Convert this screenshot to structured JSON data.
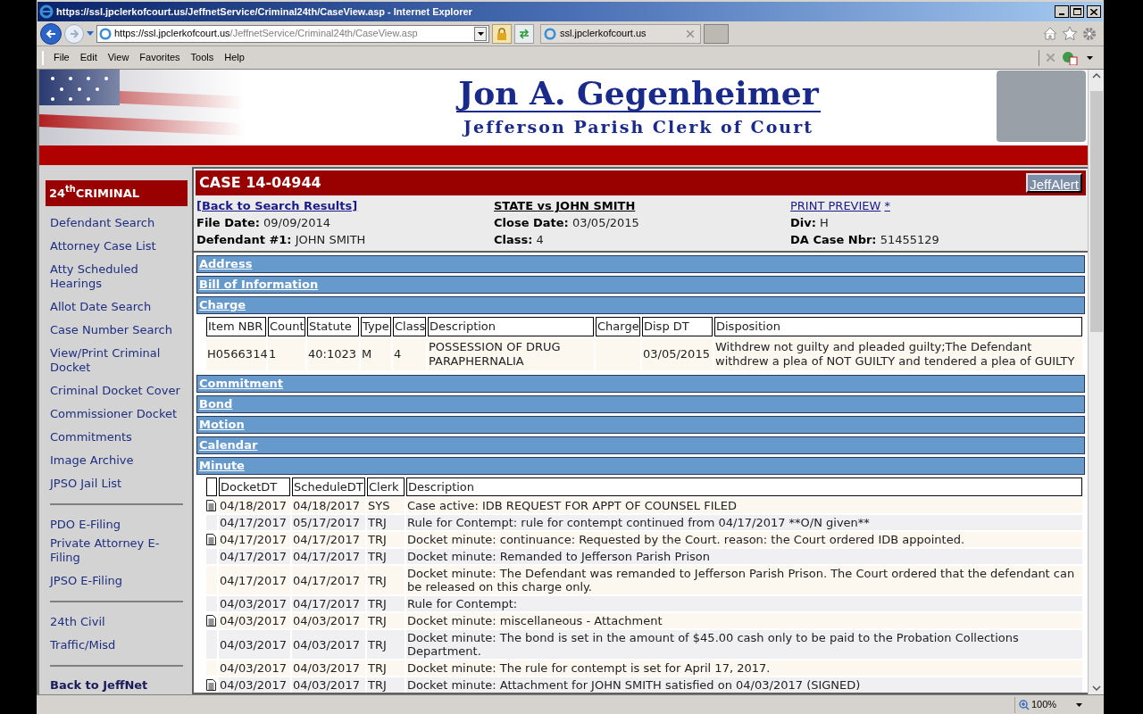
{
  "browser": {
    "title": "https://ssl.jpclerkofcourt.us/JeffnetService/Criminal24th/CaseView.asp - Internet Explorer",
    "address_host": "https://ssl.jpclerkofcourt.us",
    "address_path": "/JeffnetService/Criminal24th/CaseView.asp",
    "tab": "ssl.jpclerkofcourt.us",
    "menu": [
      "File",
      "Edit",
      "View",
      "Favorites",
      "Tools",
      "Help"
    ],
    "zoom": "100%"
  },
  "banner": {
    "name": "Jon A. Gegenheimer",
    "subtitle": "Jefferson Parish Clerk of Court"
  },
  "sidebar": {
    "header": "24$^{th}$CRIMINAL",
    "groups": [
      [
        {
          "label": "Defendant Search",
          "kind": "link"
        },
        {
          "label": "Attorney Case List",
          "kind": "link"
        },
        {
          "label": "Atty Scheduled Hearings",
          "kind": "link"
        },
        {
          "label": "Allot Date Search",
          "kind": "link"
        },
        {
          "label": "Case Number Search",
          "kind": "link"
        },
        {
          "label": "View/Print Criminal Docket",
          "kind": "link"
        },
        {
          "label": "Criminal Docket Cover",
          "kind": "link"
        },
        {
          "label": "Commissioner Docket",
          "kind": "link"
        },
        {
          "label": "Commitments",
          "kind": "link"
        },
        {
          "label": "Image Archive",
          "kind": "link"
        },
        {
          "label": "JPSO Jail List",
          "kind": "link"
        }
      ],
      [
        {
          "label": "PDO E-Filing",
          "kind": "tight"
        },
        {
          "label": "Private Attorney E-Filing",
          "kind": "link"
        },
        {
          "label": "JPSO E-Filing",
          "kind": "link"
        }
      ],
      [
        {
          "label": "24th Civil",
          "kind": "link"
        },
        {
          "label": "Traffic/Misd",
          "kind": "link"
        }
      ],
      [
        {
          "label": "Back to JeffNet",
          "kind": "bold"
        }
      ]
    ]
  },
  "case": {
    "title": "CASE 14-04944",
    "alert_button": "JeffAlert",
    "back_link": "[Back to Search Results]",
    "parties": "STATE vs JOHN SMITH",
    "print_link": "PRINT PREVIEW",
    "print_mark": "*",
    "fields": [
      {
        "label": "File Date:",
        "value": "09/09/2014"
      },
      {
        "label": "Close Date:",
        "value": "03/05/2015"
      },
      {
        "label": "Div:",
        "value": "H"
      },
      {
        "label": "Defendant #1:",
        "value": "JOHN SMITH"
      },
      {
        "label": "Class:",
        "value": "4"
      },
      {
        "label": "DA Case Nbr:",
        "value": "51455129"
      }
    ]
  },
  "sections": [
    {
      "title": "Address"
    },
    {
      "title": "Bill of Information"
    },
    {
      "title": "Charge",
      "kind": "charges",
      "table": {
        "columns": [
          "Item NBR",
          "Count",
          "Statute",
          "Type",
          "Class",
          "Description",
          "Charge",
          "Disp DT",
          "Disposition"
        ],
        "rows": [
          [
            "H0566314",
            "1",
            "40:1023",
            "M",
            "4",
            "POSSESSION OF DRUG PARAPHERNALIA",
            "",
            "03/05/2015",
            "Withdrew not guilty and pleaded guilty;The Defendant withdrew a plea of NOT GUILTY and tendered a plea of GUILTY"
          ]
        ]
      }
    },
    {
      "title": "Commitment"
    },
    {
      "title": "Bond"
    },
    {
      "title": "Motion"
    },
    {
      "title": "Calendar"
    },
    {
      "title": "Minute",
      "kind": "docket",
      "table": {
        "columns": [
          "DocketDT",
          "ScheduleDT",
          "Clerk",
          "Description"
        ],
        "rows": [
          {
            "document": true,
            "cells": [
              "04/18/2017",
              "04/18/2017",
              "SYS",
              "Case active: IDB REQUEST FOR APPT OF COUNSEL FILED"
            ]
          },
          {
            "document": false,
            "cells": [
              "04/17/2017",
              "05/17/2017",
              "TRJ",
              "Rule for Contempt: rule for contempt continued from 04/17/2017 **O/N given**"
            ]
          },
          {
            "document": true,
            "cells": [
              "04/17/2017",
              "04/17/2017",
              "TRJ",
              "Docket minute: continuance: Requested by the Court. reason: the Court ordered IDB appointed."
            ]
          },
          {
            "document": false,
            "cells": [
              "04/17/2017",
              "04/17/2017",
              "TRJ",
              "Docket minute: Remanded to Jefferson Parish Prison"
            ]
          },
          {
            "document": false,
            "cells": [
              "04/17/2017",
              "04/17/2017",
              "TRJ",
              "Docket minute: The Defendant was remanded to Jefferson Parish Prison. The Court ordered that the defendant can be released on this charge only."
            ]
          },
          {
            "document": false,
            "cells": [
              "04/03/2017",
              "04/17/2017",
              "TRJ",
              "Rule for Contempt:"
            ]
          },
          {
            "document": true,
            "cells": [
              "04/03/2017",
              "04/03/2017",
              "TRJ",
              "Docket minute: miscellaneous - Attachment"
            ]
          },
          {
            "document": false,
            "cells": [
              "04/03/2017",
              "04/03/2017",
              "TRJ",
              "Docket minute: The bond is set in the amount of $45.00 cash only to be paid to the Probation Collections Department."
            ]
          },
          {
            "document": false,
            "cells": [
              "04/03/2017",
              "04/03/2017",
              "TRJ",
              "Docket minute: The rule for contempt is set for April 17, 2017."
            ]
          },
          {
            "document": true,
            "cells": [
              "04/03/2017",
              "04/03/2017",
              "TRJ",
              "Docket minute: Attachment for JOHN SMITH satisfied on 04/03/2017 (SIGNED)"
            ]
          }
        ]
      }
    }
  ]
}
